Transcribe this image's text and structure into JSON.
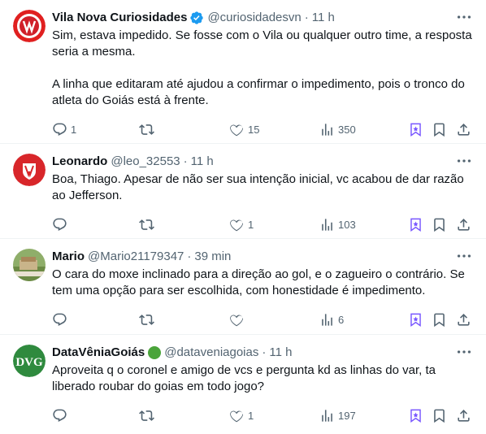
{
  "tweets": [
    {
      "name": "Vila Nova Curiosidades",
      "handle": "@curiosidadesvn",
      "time": "11 h",
      "text": "Sim, estava impedido. Se fosse com o Vila ou qualquer outro time, a resposta seria a mesma.\n\nA linha que editaram até ajudou a confirmar o impedimento, pois o tronco do atleta do Goiás está à frente.",
      "replies": "1",
      "retweets": "",
      "likes": "15",
      "views": "350"
    },
    {
      "name": "Leonardo",
      "handle": "@leo_32553",
      "time": "11 h",
      "text": "Boa, Thiago. Apesar de não ser sua intenção inicial, vc acabou de dar razão ao Jefferson.",
      "replies": "",
      "retweets": "",
      "likes": "1",
      "views": "103"
    },
    {
      "name": "Mario",
      "handle": "@Mario21179347",
      "time": "39 min",
      "text": "O cara do moxe inclinado para a direção ao gol, e o zagueiro o contrário. Se tem uma opção para ser escolhida, com honestidade é impedimento.",
      "replies": "",
      "retweets": "",
      "likes": "",
      "views": "6"
    },
    {
      "name": "DataVêniaGoiás",
      "handle": "@dataveniagoias",
      "time": "11 h",
      "text": "Aproveita q o coronel e amigo de vcs e pergunta kd as linhas do var, ta liberado roubar do goias em todo jogo?",
      "replies": "",
      "retweets": "",
      "likes": "1",
      "views": "197"
    }
  ],
  "separator": "·",
  "colors": {
    "text": "#0f1419",
    "muted": "#536471",
    "accent": "#1d9bf0",
    "premium": "#7856ff",
    "border": "#eff3f4"
  },
  "icons": [
    "more-icon",
    "reply-icon",
    "retweet-icon",
    "like-icon",
    "views-icon",
    "grok-icon",
    "bookmark-icon",
    "share-icon",
    "verified-icon"
  ]
}
